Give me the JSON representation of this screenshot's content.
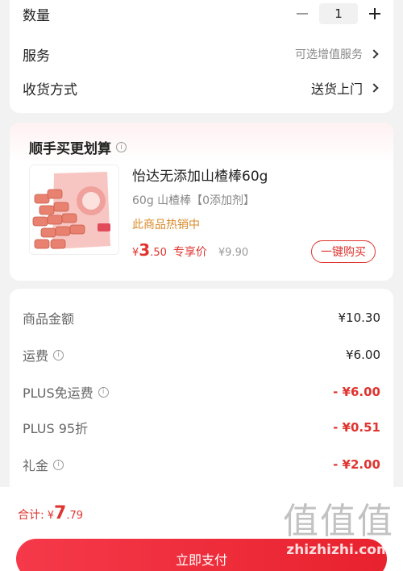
{
  "order": {
    "quantity_label": "数量",
    "quantity_value": "1",
    "service_label": "服务",
    "service_value": "可选增值服务",
    "delivery_label": "收货方式",
    "delivery_value": "送货上门"
  },
  "bundle": {
    "title": "顺手买更划算",
    "product_name": "怡达无添加山楂棒60g",
    "product_spec": "60g  山楂棒【0添加剂】",
    "hot_tag": "此商品热销中",
    "price_currency": "¥",
    "price_int": "3",
    "price_dec": ".50",
    "exclusive_label": "专享价",
    "original_price": "¥9.90",
    "buy_button": "一键购买"
  },
  "summary": {
    "rows": [
      {
        "label": "商品金额",
        "amount": "¥10.30",
        "info": false,
        "red": false
      },
      {
        "label": "运费",
        "amount": "¥6.00",
        "info": true,
        "red": false
      },
      {
        "label": "PLUS免运费",
        "amount": "- ¥6.00",
        "info": true,
        "red": true
      },
      {
        "label": "PLUS 95折",
        "amount": "- ¥0.51",
        "info": false,
        "red": true
      },
      {
        "label": "礼金",
        "amount": "- ¥2.00",
        "info": true,
        "red": true
      }
    ]
  },
  "footer": {
    "total_label": "合计:",
    "total_currency": "¥",
    "total_int": "7",
    "total_dec": ".79",
    "pay_button": "立即支付",
    "watermark_logo": "值值值",
    "watermark_url": "zhizhizhi.com"
  },
  "colors": {
    "accent": "#e0342f",
    "hot_tag": "#d98a2b"
  },
  "icons": [
    "minus-icon",
    "plus-icon",
    "chevron-right-icon",
    "info-icon"
  ]
}
